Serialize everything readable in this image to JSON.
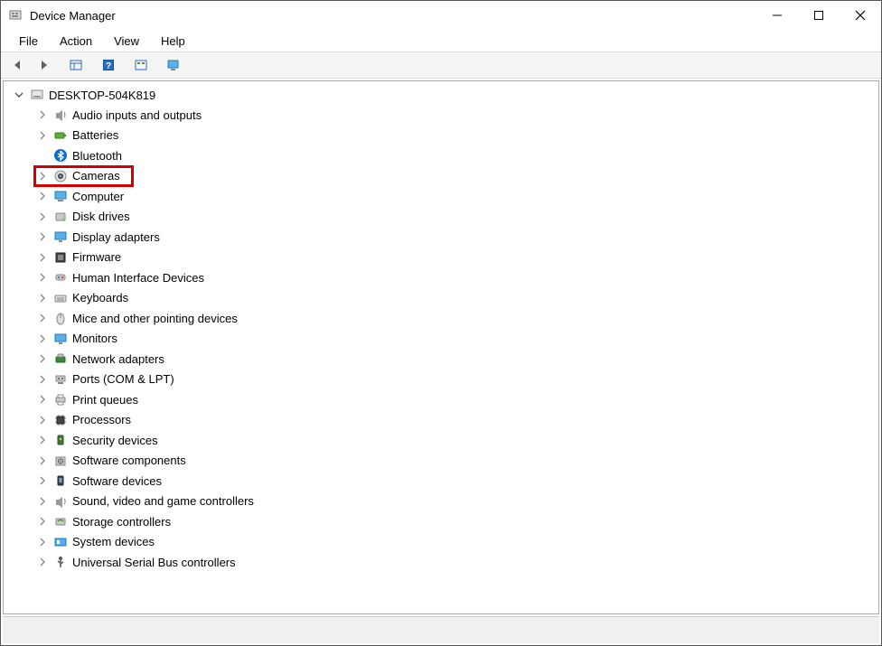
{
  "window": {
    "title": "Device Manager"
  },
  "menubar": {
    "items": [
      "File",
      "Action",
      "View",
      "Help"
    ]
  },
  "tree": {
    "root_label": "DESKTOP-504K819",
    "items": [
      {
        "label": "Audio inputs and outputs",
        "icon": "audio"
      },
      {
        "label": "Batteries",
        "icon": "battery"
      },
      {
        "label": "Bluetooth",
        "icon": "bluetooth",
        "no_chevron": true
      },
      {
        "label": "Cameras",
        "icon": "camera",
        "highlight": true
      },
      {
        "label": "Computer",
        "icon": "computer"
      },
      {
        "label": "Disk drives",
        "icon": "disk"
      },
      {
        "label": "Display adapters",
        "icon": "display"
      },
      {
        "label": "Firmware",
        "icon": "firmware"
      },
      {
        "label": "Human Interface Devices",
        "icon": "hid"
      },
      {
        "label": "Keyboards",
        "icon": "keyboard"
      },
      {
        "label": "Mice and other pointing devices",
        "icon": "mouse"
      },
      {
        "label": "Monitors",
        "icon": "monitor"
      },
      {
        "label": "Network adapters",
        "icon": "network"
      },
      {
        "label": "Ports (COM & LPT)",
        "icon": "ports"
      },
      {
        "label": "Print queues",
        "icon": "printer"
      },
      {
        "label": "Processors",
        "icon": "processor"
      },
      {
        "label": "Security devices",
        "icon": "security"
      },
      {
        "label": "Software components",
        "icon": "swcomp"
      },
      {
        "label": "Software devices",
        "icon": "swdev"
      },
      {
        "label": "Sound, video and game controllers",
        "icon": "sound"
      },
      {
        "label": "Storage controllers",
        "icon": "storage"
      },
      {
        "label": "System devices",
        "icon": "system"
      },
      {
        "label": "Universal Serial Bus controllers",
        "icon": "usb"
      }
    ]
  }
}
